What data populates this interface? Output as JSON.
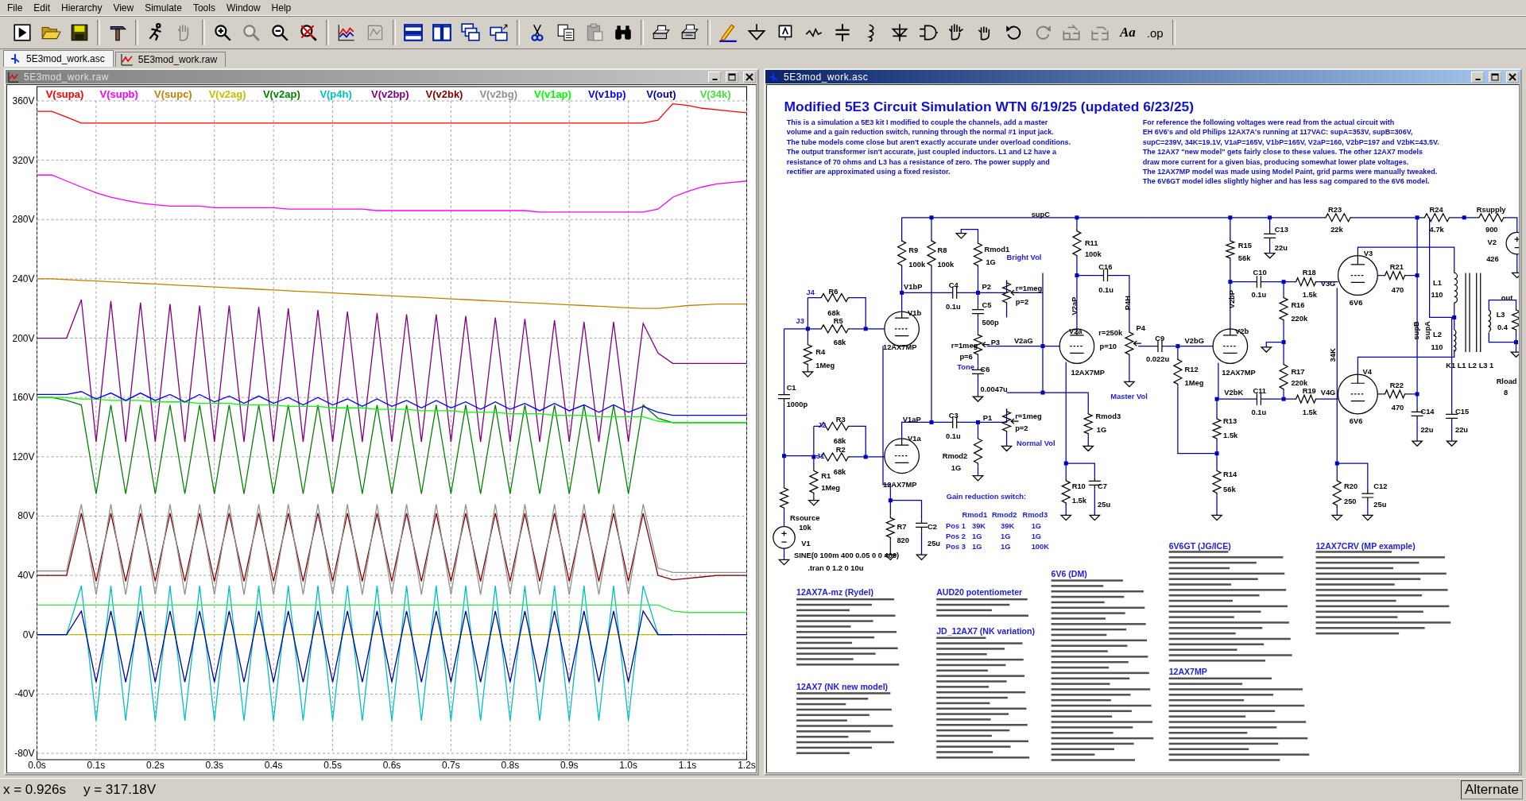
{
  "menu": [
    "File",
    "Edit",
    "Hierarchy",
    "View",
    "Simulate",
    "Tools",
    "Window",
    "Help"
  ],
  "toolbar": [
    {
      "disabled": false
    },
    {
      "disabled": false
    },
    {
      "disabled": false
    },
    {
      "disabled": false
    },
    {
      "disabled": false
    },
    {
      "disabled": true
    },
    {
      "disabled": false
    },
    {
      "disabled": true
    },
    {
      "disabled": false
    },
    {
      "disabled": false
    },
    {
      "disabled": false
    },
    {
      "disabled": true
    },
    {
      "disabled": false
    },
    {
      "disabled": false
    },
    {
      "disabled": false
    },
    {
      "disabled": false
    },
    {
      "disabled": false
    },
    {
      "disabled": false
    },
    {
      "disabled": true
    },
    {
      "disabled": false
    },
    {
      "disabled": false
    },
    {
      "disabled": false
    },
    {
      "disabled": false
    },
    {
      "disabled": false
    },
    {
      "disabled": false
    },
    {
      "disabled": false
    },
    {
      "disabled": false
    },
    {
      "disabled": false
    },
    {
      "disabled": false
    },
    {
      "disabled": false
    },
    {
      "disabled": false
    },
    {
      "disabled": false
    },
    {
      "disabled": false
    },
    {
      "disabled": true
    },
    {
      "disabled": true
    },
    {
      "disabled": true
    }
  ],
  "toolbar_text_buttons": [
    {
      "label": "Aa",
      "disabled": false
    },
    {
      "label": ".op",
      "disabled": false
    }
  ],
  "tabs": [
    {
      "label": "5E3mod_work.asc",
      "kind": "schematic",
      "selected": true
    },
    {
      "label": "5E3mod_work.raw",
      "kind": "waveform",
      "selected": false
    }
  ],
  "waveform_window": {
    "title": "5E3mod_work.raw",
    "active": false,
    "chart_data": {
      "type": "line",
      "xlim": [
        0,
        1.2
      ],
      "ylim": [
        -80,
        360
      ],
      "x": [
        0,
        0.025,
        0.05,
        0.075,
        0.1,
        0.125,
        0.15,
        0.175,
        0.2,
        0.225,
        0.25,
        0.275,
        0.3,
        0.325,
        0.35,
        0.375,
        0.4,
        0.425,
        0.45,
        0.475,
        0.5,
        0.525,
        0.55,
        0.575,
        0.6,
        0.625,
        0.65,
        0.675,
        0.7,
        0.725,
        0.75,
        0.775,
        0.8,
        0.825,
        0.85,
        0.875,
        0.9,
        0.925,
        0.95,
        0.975,
        1,
        1.025,
        1.05,
        1.075,
        1.1,
        1.125,
        1.15,
        1.175,
        1.2
      ],
      "xticks": [
        {
          "value": 0,
          "label": "0.0s"
        },
        {
          "value": 0.1,
          "label": "0.1s"
        },
        {
          "value": 0.2,
          "label": "0.2s"
        },
        {
          "value": 0.3,
          "label": "0.3s"
        },
        {
          "value": 0.4,
          "label": "0.4s"
        },
        {
          "value": 0.5,
          "label": "0.5s"
        },
        {
          "value": 0.6,
          "label": "0.6s"
        },
        {
          "value": 0.7,
          "label": "0.7s"
        },
        {
          "value": 0.8,
          "label": "0.8s"
        },
        {
          "value": 0.9,
          "label": "0.9s"
        },
        {
          "value": 1.0,
          "label": "1.0s"
        },
        {
          "value": 1.1,
          "label": "1.1s"
        },
        {
          "value": 1.2,
          "label": "1.2s"
        }
      ],
      "yticks": [
        {
          "value": 360,
          "label": "360V"
        },
        {
          "value": 320,
          "label": "320V"
        },
        {
          "value": 280,
          "label": "280V"
        },
        {
          "value": 240,
          "label": "240V"
        },
        {
          "value": 200,
          "label": "200V"
        },
        {
          "value": 160,
          "label": "160V"
        },
        {
          "value": 120,
          "label": "120V"
        },
        {
          "value": 80,
          "label": "80V"
        },
        {
          "value": 40,
          "label": "40V"
        },
        {
          "value": 0,
          "label": "0V"
        },
        {
          "value": -40,
          "label": "-40V"
        },
        {
          "value": -80,
          "label": "-80V"
        }
      ],
      "series": [
        {
          "name": "V(supa)",
          "color": "#ff0000",
          "values": [
            353,
            353,
            349,
            345,
            345,
            345,
            345,
            345,
            345,
            345,
            345,
            345,
            345,
            345,
            345,
            345,
            345,
            345,
            345,
            345,
            345,
            345,
            345,
            345,
            345,
            345,
            345,
            345,
            345,
            345,
            345,
            345,
            345,
            345,
            345,
            345,
            345,
            345,
            345,
            345,
            345,
            345,
            347,
            358,
            357,
            355,
            354,
            353,
            352
          ]
        },
        {
          "name": "V(supb)",
          "color": "#ff00ff",
          "values": [
            310,
            310,
            306,
            302,
            298,
            295,
            293,
            291,
            290,
            289,
            289,
            289,
            288,
            288,
            288,
            288,
            288,
            287,
            287,
            287,
            287,
            287,
            287,
            286,
            286,
            286,
            286,
            286,
            286,
            286,
            286,
            286,
            286,
            286,
            285,
            285,
            285,
            285,
            285,
            285,
            285,
            285,
            287,
            295,
            299,
            302,
            304,
            305,
            306
          ]
        },
        {
          "name": "V(supc)",
          "color": "#c08000",
          "values": [
            240,
            240,
            239.5,
            239,
            238.5,
            238,
            237.5,
            237,
            236.5,
            236,
            235.5,
            235,
            234.5,
            234,
            233.5,
            233,
            232.5,
            232,
            231.5,
            231,
            230.5,
            230,
            229.5,
            229,
            228.5,
            228,
            227.5,
            227,
            226.5,
            226,
            225.5,
            225,
            224.5,
            224,
            223.5,
            223,
            222.5,
            222,
            221.5,
            221,
            220.5,
            220,
            220,
            221,
            222,
            222.5,
            223,
            223,
            223
          ]
        },
        {
          "name": "V(v2ag)",
          "color": "#c0c000",
          "values": [
            0,
            0,
            0,
            0,
            0,
            0,
            0,
            0,
            0,
            0,
            0,
            0,
            0,
            0,
            0,
            0,
            0,
            0,
            0,
            0,
            0,
            0,
            0,
            0,
            0,
            0,
            0,
            0,
            0,
            0,
            0,
            0,
            0,
            0,
            0,
            0,
            0,
            0,
            0,
            0,
            0,
            0,
            0,
            0,
            null,
            null,
            null,
            null,
            null
          ]
        },
        {
          "name": "V(v2ap)",
          "color": "#008000",
          "values": [
            160,
            160,
            158,
            155,
            95,
            155,
            95,
            155,
            95,
            155,
            95,
            155,
            95,
            155,
            95,
            155,
            95,
            155,
            95,
            155,
            95,
            155,
            95,
            155,
            95,
            155,
            95,
            155,
            95,
            155,
            95,
            155,
            95,
            155,
            95,
            155,
            95,
            155,
            95,
            155,
            95,
            155,
            146,
            143,
            143,
            143,
            143,
            143,
            143
          ]
        },
        {
          "name": "V(p4h)",
          "color": "#00c0c0",
          "values": [
            0,
            0,
            0,
            33,
            -58,
            33,
            -58,
            33,
            -58,
            33,
            -58,
            33,
            -58,
            33,
            -58,
            33,
            -58,
            33,
            -58,
            33,
            -58,
            33,
            -58,
            33,
            -58,
            33,
            -58,
            33,
            -58,
            33,
            -58,
            33,
            -58,
            33,
            -58,
            33,
            -58,
            33,
            -58,
            33,
            -58,
            33,
            0,
            0,
            null,
            null,
            null,
            null,
            null
          ]
        },
        {
          "name": "V(v2bp)",
          "color": "#800080",
          "values": [
            200,
            200,
            200,
            226,
            130,
            225,
            130,
            224,
            130,
            223,
            130,
            222,
            130,
            222,
            130,
            221,
            130,
            220,
            130,
            219,
            130,
            218,
            130,
            217,
            130,
            216,
            130,
            216,
            130,
            215,
            130,
            214,
            130,
            213,
            130,
            212,
            130,
            211,
            130,
            211,
            130,
            210,
            190,
            183,
            183,
            183,
            183,
            183,
            183
          ]
        },
        {
          "name": "V(v2bk)",
          "color": "#800000",
          "values": [
            40,
            40,
            40,
            82,
            36,
            82,
            36,
            82,
            36,
            82,
            36,
            82,
            36,
            82,
            36,
            82,
            36,
            82,
            36,
            82,
            36,
            82,
            36,
            82,
            36,
            82,
            36,
            82,
            36,
            82,
            36,
            82,
            36,
            82,
            36,
            82,
            36,
            82,
            36,
            82,
            36,
            82,
            40,
            37,
            38,
            39,
            40,
            40,
            40
          ]
        },
        {
          "name": "V(v2bg)",
          "color": "#909090",
          "values": [
            43,
            43,
            43,
            88,
            27,
            88,
            27,
            88,
            27,
            88,
            27,
            88,
            27,
            88,
            27,
            88,
            27,
            88,
            27,
            88,
            27,
            88,
            27,
            88,
            27,
            88,
            27,
            88,
            27,
            88,
            27,
            88,
            27,
            88,
            27,
            88,
            27,
            88,
            27,
            88,
            27,
            88,
            45,
            42,
            42,
            42,
            42,
            42,
            42
          ]
        },
        {
          "name": "V(v1ap)",
          "color": "#00ff00",
          "values": [
            160,
            160,
            160,
            159,
            159,
            158,
            158,
            158,
            157,
            157,
            157,
            156,
            156,
            156,
            155,
            155,
            155,
            154,
            154,
            154,
            153,
            153,
            153,
            152,
            152,
            152,
            151,
            151,
            151,
            150,
            150,
            150,
            149,
            149,
            149,
            148,
            148,
            148,
            147,
            147,
            147,
            147,
            144,
            143,
            143,
            143,
            143,
            143,
            143
          ]
        },
        {
          "name": "V(v1bp)",
          "color": "#0000ff",
          "values": [
            162,
            162,
            162,
            164,
            159,
            163,
            158,
            163,
            158,
            162,
            157,
            162,
            157,
            161,
            156,
            161,
            156,
            160,
            155,
            160,
            155,
            159,
            154,
            159,
            154,
            158,
            153,
            158,
            153,
            157,
            152,
            157,
            152,
            156,
            151,
            156,
            151,
            155,
            150,
            155,
            150,
            154,
            150,
            148,
            148,
            148,
            148,
            148,
            148
          ]
        },
        {
          "name": "V(out)",
          "color": "#0000a0",
          "values": [
            0,
            0,
            0,
            16,
            -32,
            16,
            -32,
            16,
            -32,
            16,
            -32,
            16,
            -32,
            16,
            -32,
            16,
            -32,
            16,
            -32,
            16,
            -32,
            16,
            -32,
            16,
            -32,
            16,
            -32,
            16,
            -32,
            16,
            -32,
            16,
            -32,
            16,
            -32,
            16,
            -32,
            16,
            -32,
            16,
            -32,
            16,
            0,
            0,
            0,
            0,
            0,
            0,
            0
          ]
        },
        {
          "name": "V(34k)",
          "color": "#40e040",
          "values": [
            20,
            20,
            20,
            20,
            20,
            20,
            20,
            20,
            20,
            20,
            20,
            20,
            20,
            20,
            20,
            20,
            20,
            20,
            20,
            20,
            20,
            20,
            20,
            20,
            20,
            20,
            20,
            20,
            20,
            20,
            20,
            20,
            20,
            20,
            20,
            20,
            20,
            20,
            20,
            20,
            20,
            20,
            20,
            16,
            15,
            15,
            15,
            15,
            15
          ]
        }
      ]
    }
  },
  "schematic_window": {
    "title": "5E3mod_work.asc",
    "active": true,
    "heading": "Modified 5E3 Circuit Simulation  WTN 6/19/25 (updated 6/23/25)",
    "notes": [
      {
        "lines": [
          "This is a simulation a 5E3 kit I modified to couple the channels, add a master",
          "volume and a gain reduction switch, running through the normal #1 input jack.",
          "The tube models come close but aren't exactly accurate under overload conditions.",
          "The output transformer isn't accurate, just coupled inductors. L1 and L2 have a",
          "resistance of 70 ohms and L3 has a resistance of zero. The power supply and",
          "rectifier are approximated using a fixed resistor."
        ]
      },
      {
        "lines": [
          "For reference the following voltages were read from the actual circuit with",
          "EH 6V6's and old Philips 12AX7A's running at 117VAC: supA=353V, supB=306V,",
          "supC=239V, 34K=19.1V, V1aP=165V, V1bP=165V, V2aP=160, V2bP=197 and V2bK=43.5V.",
          "The 12AX7 \"new model\" gets fairly close to these values. The other 12AX7 models",
          "draw more current for a given bias, producing somewhat lower plate voltages.",
          "The 12AX7MP model was made using Model Paint, grid parms were manually tweaked.",
          "The 6V6GT model idles slightly higher and has less sag compared to the 6V6 model."
        ]
      }
    ],
    "labels": [
      {
        "text": "supC",
        "kind": "label"
      },
      {
        "text": "R23",
        "kind": "label"
      },
      {
        "text": "22k",
        "kind": "label"
      },
      {
        "text": "R24",
        "kind": "label"
      },
      {
        "text": "4.7k",
        "kind": "label"
      },
      {
        "text": "Rsupply",
        "kind": "label"
      },
      {
        "text": "900",
        "kind": "label"
      },
      {
        "text": "V2",
        "kind": "label"
      },
      {
        "text": "426",
        "kind": "label"
      },
      {
        "text": "C13",
        "kind": "label"
      },
      {
        "text": "22u",
        "kind": "label"
      },
      {
        "text": "R9",
        "kind": "label"
      },
      {
        "text": "100k",
        "kind": "label"
      },
      {
        "text": "R8",
        "kind": "label"
      },
      {
        "text": "100k",
        "kind": "label"
      },
      {
        "text": "Rmod1",
        "kind": "label"
      },
      {
        "text": "1G",
        "kind": "label"
      },
      {
        "text": "R11",
        "kind": "label"
      },
      {
        "text": "100k",
        "kind": "label"
      },
      {
        "text": "Bright Vol",
        "kind": "comment"
      },
      {
        "text": "R15",
        "kind": "label"
      },
      {
        "text": "56k",
        "kind": "label"
      },
      {
        "text": "C16",
        "kind": "label"
      },
      {
        "text": "0.1u",
        "kind": "label"
      },
      {
        "text": "V3",
        "kind": "label"
      },
      {
        "text": "R21",
        "kind": "label"
      },
      {
        "text": "470",
        "kind": "label"
      },
      {
        "text": "L1",
        "kind": "label"
      },
      {
        "text": "110",
        "kind": "label"
      },
      {
        "text": "J4",
        "kind": "comment"
      },
      {
        "text": "R6",
        "kind": "label"
      },
      {
        "text": "68k",
        "kind": "label"
      },
      {
        "text": "V1bP",
        "kind": "label"
      },
      {
        "text": "C4",
        "kind": "label"
      },
      {
        "text": "P2",
        "kind": "label"
      },
      {
        "text": "r=1meg",
        "kind": "label"
      },
      {
        "text": "p=2",
        "kind": "label"
      },
      {
        "text": "0.1u",
        "kind": "label"
      },
      {
        "text": "C5",
        "kind": "label"
      },
      {
        "text": "500p",
        "kind": "label"
      },
      {
        "text": "C10",
        "kind": "label"
      },
      {
        "text": "0.1u",
        "kind": "label"
      },
      {
        "text": "R18",
        "kind": "label"
      },
      {
        "text": "1.5k",
        "kind": "label"
      },
      {
        "text": "V3G",
        "kind": "label"
      },
      {
        "text": "6V6",
        "kind": "label"
      },
      {
        "text": "out",
        "kind": "label"
      },
      {
        "text": "V1b",
        "kind": "label"
      },
      {
        "text": "V2aP",
        "kind": "label"
      },
      {
        "text": "P4H",
        "kind": "label"
      },
      {
        "text": "V2bP",
        "kind": "label"
      },
      {
        "text": "R16",
        "kind": "label"
      },
      {
        "text": "220k",
        "kind": "label"
      },
      {
        "text": "L3",
        "kind": "label"
      },
      {
        "text": "0.4",
        "kind": "label"
      },
      {
        "text": "J3",
        "kind": "comment"
      },
      {
        "text": "R5",
        "kind": "label"
      },
      {
        "text": "68k",
        "kind": "label"
      },
      {
        "text": "r=1meg",
        "kind": "label"
      },
      {
        "text": "P3",
        "kind": "label"
      },
      {
        "text": "V2aG",
        "kind": "label"
      },
      {
        "text": "V2a",
        "kind": "label"
      },
      {
        "text": "r=250k",
        "kind": "label"
      },
      {
        "text": "P4",
        "kind": "label"
      },
      {
        "text": "C9",
        "kind": "label"
      },
      {
        "text": "V2bG",
        "kind": "label"
      },
      {
        "text": "V2b",
        "kind": "label"
      },
      {
        "text": "L2",
        "kind": "label"
      },
      {
        "text": "110",
        "kind": "label"
      },
      {
        "text": "supB",
        "kind": "label"
      },
      {
        "text": "supA",
        "kind": "label"
      },
      {
        "text": "34K",
        "kind": "label"
      },
      {
        "text": "R4",
        "kind": "label"
      },
      {
        "text": "1Meg",
        "kind": "label"
      },
      {
        "text": "12AX7MP",
        "kind": "label"
      },
      {
        "text": "p=6",
        "kind": "label"
      },
      {
        "text": "p=10",
        "kind": "label"
      },
      {
        "text": "0.022u",
        "kind": "label"
      },
      {
        "text": "Tone",
        "kind": "comment"
      },
      {
        "text": "C6",
        "kind": "label"
      },
      {
        "text": "12AX7MP",
        "kind": "label"
      },
      {
        "text": "R12",
        "kind": "label"
      },
      {
        "text": "1Meg",
        "kind": "label"
      },
      {
        "text": "12AX7MP",
        "kind": "label"
      },
      {
        "text": "K1 L1 L2 L3 1",
        "kind": "label"
      },
      {
        "text": "R17",
        "kind": "label"
      },
      {
        "text": "220k",
        "kind": "label"
      },
      {
        "text": "V4",
        "kind": "label"
      },
      {
        "text": "Rload",
        "kind": "label"
      },
      {
        "text": "8",
        "kind": "label"
      },
      {
        "text": "0.0047u",
        "kind": "label"
      },
      {
        "text": "Master Vol",
        "kind": "comment"
      },
      {
        "text": "C1",
        "kind": "label"
      },
      {
        "text": "1000p",
        "kind": "label"
      },
      {
        "text": "V2bK",
        "kind": "label"
      },
      {
        "text": "C11",
        "kind": "label"
      },
      {
        "text": "0.1u",
        "kind": "label"
      },
      {
        "text": "R19",
        "kind": "label"
      },
      {
        "text": "1.5k",
        "kind": "label"
      },
      {
        "text": "V4G",
        "kind": "label"
      },
      {
        "text": "R22",
        "kind": "label"
      },
      {
        "text": "470",
        "kind": "label"
      },
      {
        "text": "6V6",
        "kind": "label"
      },
      {
        "text": "C14",
        "kind": "label"
      },
      {
        "text": "22u",
        "kind": "label"
      },
      {
        "text": "C15",
        "kind": "label"
      },
      {
        "text": "22u",
        "kind": "label"
      },
      {
        "text": "V1aP",
        "kind": "label"
      },
      {
        "text": "C3",
        "kind": "label"
      },
      {
        "text": "P1",
        "kind": "label"
      },
      {
        "text": "r=1meg",
        "kind": "label"
      },
      {
        "text": "0.1u",
        "kind": "label"
      },
      {
        "text": "p=2",
        "kind": "label"
      },
      {
        "text": "Rmod3",
        "kind": "label"
      },
      {
        "text": "1G",
        "kind": "label"
      },
      {
        "text": "R13",
        "kind": "label"
      },
      {
        "text": "1.5k",
        "kind": "label"
      },
      {
        "text": "J2",
        "kind": "comment"
      },
      {
        "text": "R3",
        "kind": "label"
      },
      {
        "text": "68k",
        "kind": "label"
      },
      {
        "text": "V1a",
        "kind": "label"
      },
      {
        "text": "Normal Vol",
        "kind": "comment"
      },
      {
        "text": "J1",
        "kind": "comment"
      },
      {
        "text": "R2",
        "kind": "label"
      },
      {
        "text": "68k",
        "kind": "label"
      },
      {
        "text": "Rmod2",
        "kind": "label"
      },
      {
        "text": "1G",
        "kind": "label"
      },
      {
        "text": "R1",
        "kind": "label"
      },
      {
        "text": "1Meg",
        "kind": "label"
      },
      {
        "text": "12AX7MP",
        "kind": "label"
      },
      {
        "text": "R10",
        "kind": "label"
      },
      {
        "text": "C7",
        "kind": "label"
      },
      {
        "text": "R14",
        "kind": "label"
      },
      {
        "text": "R20",
        "kind": "label"
      },
      {
        "text": "C12",
        "kind": "label"
      },
      {
        "text": "Gain reduction switch:",
        "kind": "comment"
      },
      {
        "text": "1.5k",
        "kind": "label"
      },
      {
        "text": "25u",
        "kind": "label"
      },
      {
        "text": "56k",
        "kind": "label"
      },
      {
        "text": "250",
        "kind": "label"
      },
      {
        "text": "25u",
        "kind": "label"
      },
      {
        "text": "Rsource",
        "kind": "label"
      },
      {
        "text": "Rmod1",
        "kind": "comment"
      },
      {
        "text": "Rmod2",
        "kind": "comment"
      },
      {
        "text": "Rmod3",
        "kind": "comment"
      },
      {
        "text": "10k",
        "kind": "label"
      },
      {
        "text": "R7",
        "kind": "label"
      },
      {
        "text": "C2",
        "kind": "label"
      },
      {
        "text": "Pos 1",
        "kind": "comment"
      },
      {
        "text": "39K",
        "kind": "comment"
      },
      {
        "text": "39K",
        "kind": "comment"
      },
      {
        "text": "1G",
        "kind": "comment"
      },
      {
        "text": "820",
        "kind": "label"
      },
      {
        "text": "Pos 2",
        "kind": "comment"
      },
      {
        "text": "1G",
        "kind": "comment"
      },
      {
        "text": "1G",
        "kind": "comment"
      },
      {
        "text": "1G",
        "kind": "comment"
      },
      {
        "text": "V1",
        "kind": "label"
      },
      {
        "text": "25u",
        "kind": "label"
      },
      {
        "text": "Pos 3",
        "kind": "comment"
      },
      {
        "text": "1G",
        "kind": "comment"
      },
      {
        "text": "1G",
        "kind": "comment"
      },
      {
        "text": "100K",
        "kind": "comment"
      },
      {
        "text": "SINE(0 100m 400 0.05 0 0 400)",
        "kind": "label"
      },
      {
        "text": ".tran 0 1.2 0 10u",
        "kind": "label"
      }
    ],
    "models": [
      "6V6GT   (JG/ICE)",
      "12AX7CRV (MP example)",
      "6V6   (DM)",
      "12AX7A-mz   (Rydel)",
      "AUD20 potentiometer",
      "JD_12AX7 (NK variation)",
      "12AX7MP",
      "12AX7    (NK new model)"
    ]
  },
  "status_bar": {
    "x_reading": "x = 0.926s",
    "y_reading": "y = 317.18V",
    "mode": "Alternate"
  }
}
